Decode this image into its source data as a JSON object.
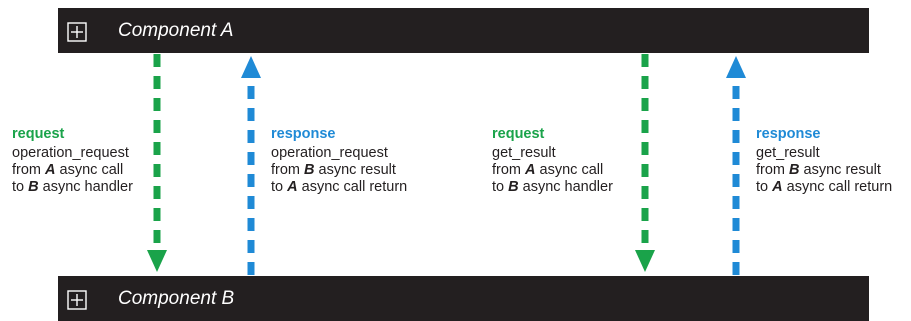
{
  "component_a": {
    "title": "Component A",
    "icon": "expand-box-icon"
  },
  "component_b": {
    "title": "Component B",
    "icon": "expand-box-icon"
  },
  "colors": {
    "request": "#1aa34a",
    "response": "#1f8ad6",
    "bar": "#231f20"
  },
  "flows": [
    {
      "kind": "request",
      "direction": "A-to-B",
      "label": "request",
      "method": "operation_request",
      "line2_pre": "from ",
      "line2_actor": "A",
      "line2_post": " async call",
      "line3_pre": "to ",
      "line3_actor": "B",
      "line3_post": " async handler"
    },
    {
      "kind": "response",
      "direction": "B-to-A",
      "label": "response",
      "method": "operation_request",
      "line2_pre": "from ",
      "line2_actor": "B",
      "line2_post": " async result",
      "line3_pre": "to ",
      "line3_actor": "A",
      "line3_post": " async call return"
    },
    {
      "kind": "request",
      "direction": "A-to-B",
      "label": "request",
      "method": "get_result",
      "line2_pre": "from ",
      "line2_actor": "A",
      "line2_post": " async call",
      "line3_pre": "to ",
      "line3_actor": "B",
      "line3_post": " async handler"
    },
    {
      "kind": "response",
      "direction": "B-to-A",
      "label": "response",
      "method": "get_result",
      "line2_pre": "from ",
      "line2_actor": "B",
      "line2_post": " async result",
      "line3_pre": "to ",
      "line3_actor": "A",
      "line3_post": " async call return"
    }
  ]
}
